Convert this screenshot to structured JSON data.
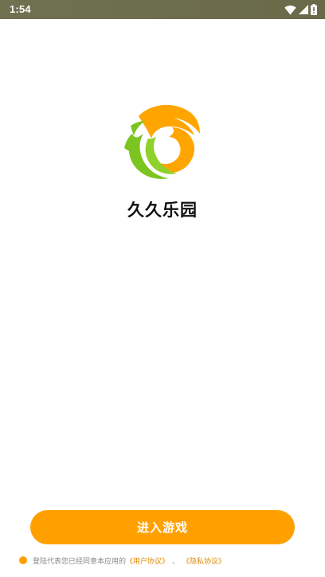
{
  "status_bar": {
    "time": "1:54",
    "icons": [
      "wifi-icon",
      "cellular-signal-icon",
      "battery-icon"
    ],
    "background": "#6b6b4b"
  },
  "app": {
    "logo": "app-logo-swirl",
    "title": "久久乐园",
    "logo_colors": {
      "orange": "#ffa500",
      "green": "#7cc420"
    }
  },
  "enter_button": {
    "label": "进入游戏",
    "color": "#ffa000"
  },
  "agreement": {
    "text": "登陆代表您已经同意本应用的",
    "user_agreement_link": "《用户协议》",
    "separator": "、",
    "privacy_policy_link": "《隐私协议》"
  }
}
